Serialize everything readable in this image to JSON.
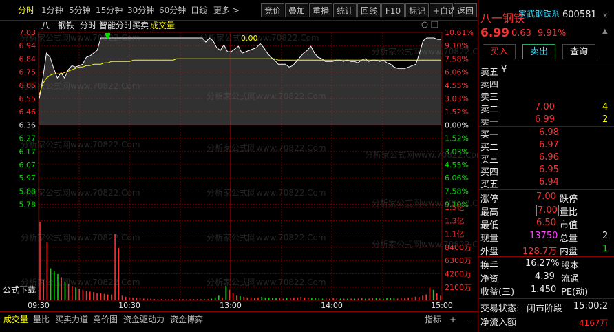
{
  "toolbar": {
    "left_items": [
      "分时",
      "1分钟",
      "5分钟",
      "15分钟",
      "30分钟",
      "60分钟",
      "日线",
      "更多 >"
    ],
    "right_items": [
      "竞价",
      "叠加",
      "重播",
      "统计",
      "回线",
      "F10",
      "标记",
      "+自选",
      "返回"
    ]
  },
  "chart": {
    "stock_name": "八一钢铁",
    "mode_label": "分时",
    "indicator_label": "智能分时买卖",
    "volume_legend": "成交量",
    "zero_label": "0.00",
    "formula_download": "公式下载",
    "watermark": "分析家公式网www.70822.Com",
    "price_labels": [
      "7.03",
      "6.94",
      "6.84",
      "6.75",
      "6.65",
      "6.55",
      "6.46",
      "6.36",
      "6.27",
      "6.17",
      "6.07",
      "5.97",
      "5.88",
      "5.78"
    ],
    "pct_labels": [
      "10.61%",
      "9.10%",
      "7.58%",
      "6.06%",
      "4.55%",
      "3.03%",
      "1.52%",
      "0.00%",
      "1.52%",
      "3.03%",
      "4.55%",
      "6.06%",
      "7.58%",
      "9.10%"
    ],
    "vol_labels": [
      "1.5亿",
      "1.3亿",
      "1.1亿",
      "8400万",
      "6300万",
      "4200万",
      "2100万"
    ],
    "time_labels": [
      "09:30",
      "10:30",
      "13:00",
      "14:00",
      "15:00"
    ],
    "prev_close": 6.36,
    "price_top": 7.03,
    "price_step": 0.0955,
    "price_points": [
      6.55,
      6.7,
      6.88,
      6.85,
      6.77,
      6.7,
      6.74,
      6.7,
      6.76,
      6.79,
      6.78,
      6.79,
      6.8,
      6.85,
      6.86,
      6.88,
      6.9,
      6.99,
      6.99,
      6.99,
      6.99,
      6.99,
      6.99,
      6.99,
      6.99,
      6.99,
      6.99,
      6.99,
      6.99,
      6.99,
      6.99,
      6.99,
      6.99,
      6.99,
      6.99,
      6.99,
      6.99,
      6.99,
      6.99,
      6.99,
      6.99,
      6.99,
      6.99,
      6.99,
      6.99,
      6.99,
      6.96,
      6.99,
      6.97,
      6.92,
      6.9,
      6.94,
      6.89,
      6.89,
      6.91,
      6.93,
      6.88,
      6.89,
      6.9,
      6.91,
      6.92,
      6.95,
      6.92,
      6.88,
      6.85,
      6.83,
      6.8,
      6.8,
      6.8,
      6.78,
      6.79,
      6.82,
      6.85,
      6.88,
      6.9,
      6.93,
      6.88,
      6.85,
      6.84,
      6.82,
      6.82,
      6.82,
      6.83,
      6.83,
      6.82,
      6.83,
      6.82,
      6.82,
      6.81,
      6.83,
      6.84,
      6.82,
      6.83,
      6.83,
      6.82,
      6.83,
      6.81,
      6.8,
      6.78,
      6.77,
      6.77,
      6.77,
      6.78,
      6.79,
      6.8,
      6.88,
      6.97,
      6.99,
      6.99,
      6.99,
      6.98,
      6.98
    ],
    "avg_points": [
      6.58,
      6.66,
      6.7,
      6.72,
      6.73,
      6.73,
      6.73,
      6.74,
      6.75,
      6.76,
      6.77,
      6.78,
      6.78,
      6.79,
      6.79,
      6.8,
      6.8,
      6.8,
      6.81,
      6.81,
      6.82,
      6.82,
      6.82,
      6.82,
      6.82,
      6.82,
      6.83,
      6.83,
      6.83,
      6.83,
      6.83,
      6.83,
      6.83,
      6.83,
      6.83,
      6.83,
      6.83,
      6.83,
      6.84,
      6.84,
      6.84,
      6.84,
      6.84,
      6.84,
      6.84,
      6.84,
      6.84,
      6.84,
      6.84,
      6.84,
      6.84,
      6.84,
      6.84,
      6.84,
      6.84,
      6.84,
      6.84,
      6.84,
      6.84,
      6.84,
      6.84,
      6.84,
      6.84,
      6.84,
      6.84,
      6.84,
      6.83,
      6.83,
      6.83,
      6.83,
      6.83,
      6.83,
      6.83,
      6.83,
      6.83,
      6.83,
      6.83,
      6.83,
      6.83,
      6.83,
      6.83,
      6.83,
      6.83,
      6.83,
      6.83,
      6.83,
      6.83,
      6.83,
      6.83,
      6.83,
      6.83,
      6.83,
      6.83,
      6.83,
      6.83,
      6.83,
      6.83,
      6.83,
      6.83,
      6.83,
      6.83,
      6.83,
      6.83,
      6.83,
      6.83,
      6.83,
      6.83,
      6.83,
      6.83,
      6.83,
      6.83,
      6.83
    ],
    "volume_bars": [
      1.35,
      0.35,
      1.0,
      0.55,
      0.5,
      0.45,
      0.4,
      0.32,
      0.28,
      0.25,
      0.22,
      0.2,
      0.18,
      0.16,
      0.15,
      0.14,
      0.12,
      0.12,
      0.11,
      0.1,
      0.1,
      1.15,
      0.9,
      0.08,
      0.06,
      0.05,
      0.05,
      0.04,
      0.04,
      0.03,
      0.03,
      0.03,
      0.02,
      0.02,
      0.02,
      0.02,
      0.02,
      0.02,
      0.02,
      0.02,
      0.02,
      0.02,
      0.02,
      0.02,
      0.02,
      0.02,
      0.02,
      0.02,
      0.03,
      0.05,
      0.08,
      0.05,
      0.25,
      0.18,
      0.12,
      0.08,
      0.07,
      0.06,
      0.05,
      0.05,
      0.04,
      0.05,
      0.06,
      0.05,
      0.05,
      0.04,
      0.04,
      0.04,
      0.03,
      0.04,
      0.04,
      0.05,
      0.05,
      0.06,
      0.05,
      0.05,
      0.04,
      0.04,
      0.04,
      0.03,
      0.03,
      0.03,
      0.04,
      0.04,
      0.03,
      0.03,
      0.03,
      0.03,
      0.03,
      0.03,
      0.04,
      0.03,
      0.03,
      0.04,
      0.04,
      0.03,
      0.03,
      0.04,
      0.04,
      0.04,
      0.03,
      0.04,
      0.04,
      0.05,
      0.05,
      0.06,
      0.06,
      0.08,
      0.1,
      0.22,
      0.18,
      0.12,
      0.08
    ],
    "volume_max": 1.6
  },
  "panel": {
    "title": "八一钢铁",
    "code": "600581",
    "ticker_scroll": "宝武钢铁系",
    "price": "6.99",
    "change": "0.63",
    "pct": "9.91%",
    "buy_btn": "买入",
    "sell_btn": "卖出",
    "query_btn": "查询",
    "sell_rows": [
      {
        "label": "卖五",
        "price": "",
        "vol": "",
        "extra": "¥"
      },
      {
        "label": "卖四",
        "price": "",
        "vol": ""
      },
      {
        "label": "卖三",
        "price": "",
        "vol": ""
      },
      {
        "label": "卖二",
        "price": "7.00",
        "vol": "4"
      },
      {
        "label": "卖一",
        "price": "6.99",
        "vol": "2"
      }
    ],
    "buy_rows": [
      {
        "label": "买一",
        "price": "6.98"
      },
      {
        "label": "买二",
        "price": "6.97"
      },
      {
        "label": "买三",
        "price": "6.96"
      },
      {
        "label": "买四",
        "price": "6.95"
      },
      {
        "label": "买五",
        "price": "6.94"
      }
    ],
    "stats": [
      {
        "l1": "涨停",
        "v1": "7.00",
        "l2": "跌停"
      },
      {
        "l1": "最高",
        "v1": "7.00",
        "l2": "量比"
      },
      {
        "l1": "最低",
        "v1": "6.50",
        "l2": "市值"
      },
      {
        "l1": "现量",
        "v1": "13750",
        "l2": "总量",
        "v2": "2"
      },
      {
        "l1": "外盘",
        "v1": "128.7万",
        "l2": "内盘",
        "v2": "1"
      },
      {
        "l1": "换手",
        "v1": "16.27%",
        "l2": "股本"
      },
      {
        "l1": "净资",
        "v1": "4.39",
        "l2": "流通"
      },
      {
        "l1": "收益(三)",
        "v1": "1.450",
        "l2": "PE(动)"
      }
    ],
    "trade_status_label": "交易状态:",
    "trade_status": "闭市阶段",
    "trade_time": "15:00:2",
    "net_inflow_label": "净流入额",
    "net_inflow": "4167万"
  },
  "tabs": {
    "items": [
      "成交量",
      "量比",
      "买卖力道",
      "竞价图",
      "资金驱动力",
      "资金博弈"
    ],
    "right_items": [
      "指标",
      "+",
      "-"
    ]
  },
  "colors": {
    "grid": "#8b0000",
    "price_line": "#ffffff",
    "avg_line": "#ffff00",
    "up": "#ff3030",
    "down": "#00e000"
  }
}
